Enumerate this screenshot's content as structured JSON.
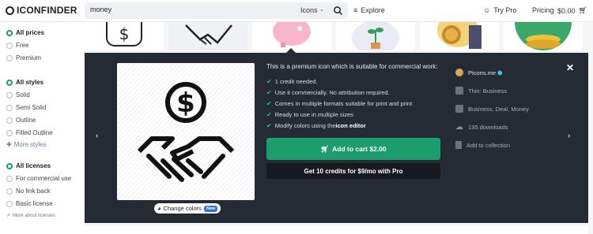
{
  "header": {
    "logo": "ICONFINDER",
    "search": {
      "value": "money",
      "type": "Icons"
    },
    "nav": {
      "explore": "Explore",
      "try_pro": "Try Pro",
      "pricing": "Pricing",
      "cart": "$0.00"
    }
  },
  "sidebar": {
    "prices": {
      "title": "All prices",
      "options": [
        "Free",
        "Premium"
      ]
    },
    "styles": {
      "title": "All styles",
      "options": [
        "Solid",
        "Semi Solid",
        "Outline",
        "Filled Outline"
      ],
      "more": "More styles"
    },
    "licenses": {
      "title": "All licenses",
      "options": [
        "For commercial use",
        "No link back",
        "Basic license"
      ],
      "more": "More about licenses"
    }
  },
  "detail": {
    "intro": "This is a premium icon which is suitable for commercial work:",
    "features": [
      "1 credit needed.",
      "Use it commercially. No attribution required.",
      "Comes in multiple formats suitable for print and print",
      "Ready to use in multiple sizes",
      "Modify colors using the "
    ],
    "icon_editor": "icon editor",
    "add_to_cart": "Add to cart $2.00",
    "credits": "Get 10 credits for $9/mo with Pro",
    "change_colors": "Change colors",
    "new_badge": "New",
    "author": "Picons.me",
    "style": "Thin: Business",
    "tags": "Business, Deal, Money",
    "downloads": "135 downloads",
    "collection": "Add to collection"
  },
  "colors": {
    "accent": "#1c9d6c",
    "panel": "#252b34",
    "radio_on": "#1c9d5c"
  }
}
